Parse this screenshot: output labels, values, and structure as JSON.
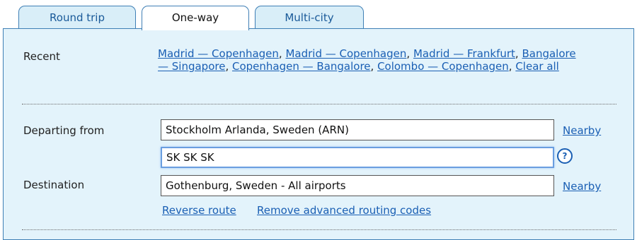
{
  "tabs": [
    {
      "label": "Round trip"
    },
    {
      "label": "One-way"
    },
    {
      "label": "Multi-city"
    }
  ],
  "recent": {
    "label": "Recent",
    "links": [
      "Madrid — Copenhagen",
      "Madrid — Copenhagen",
      "Madrid — Frankfurt",
      "Bangalore — Singapore",
      "Copenhagen — Bangalore",
      "Colombo — Copenhagen"
    ],
    "clear_all": "Clear all"
  },
  "departing": {
    "label": "Departing from",
    "value": "Stockholm Arlanda, Sweden (ARN)",
    "nearby": "Nearby"
  },
  "routing": {
    "value": "SK SK SK",
    "help_icon": "question-circle-icon",
    "help_glyph": "?"
  },
  "destination": {
    "label": "Destination",
    "value": "Gothenburg, Sweden - All airports",
    "nearby": "Nearby"
  },
  "actions": {
    "reverse_route": "Reverse route",
    "remove_codes": "Remove advanced routing codes"
  },
  "colors": {
    "panel_bg": "#e3f3fb",
    "border": "#3f7fb5",
    "link": "#1a5fb4",
    "focus": "#6a9ee0"
  }
}
